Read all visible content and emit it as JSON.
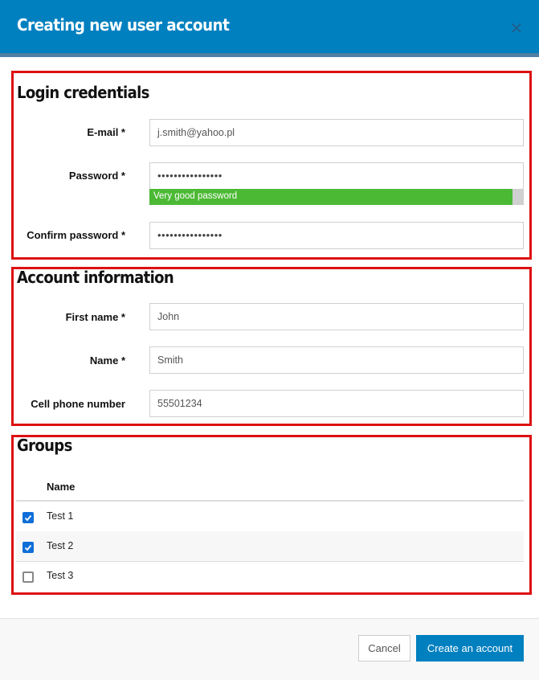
{
  "dialog": {
    "title": "Creating new user account",
    "close_icon": "close-x-icon",
    "colors": {
      "header": "#0180c0",
      "highlight_border": "#dd1111",
      "strength_good": "#4cb935",
      "primary_button": "#0180c0",
      "checkbox": "#0f6ed8"
    }
  },
  "login": {
    "title": "Login credentials",
    "email": {
      "label": "E-mail *",
      "value": "j.smith@yahoo.pl"
    },
    "password": {
      "label": "Password *",
      "value": "••••••••••••••••"
    },
    "strength": {
      "text": "Very good password",
      "fill_percent": 97
    },
    "confirm": {
      "label": "Confirm password *",
      "value": "••••••••••••••••"
    }
  },
  "account": {
    "title": "Account information",
    "first_name": {
      "label": "First name *",
      "value": "John"
    },
    "name": {
      "label": "Name *",
      "value": "Smith"
    },
    "phone": {
      "label": "Cell phone number",
      "value": "55501234"
    }
  },
  "groups": {
    "title": "Groups",
    "column_header": "Name",
    "rows": [
      {
        "name": "Test 1",
        "checked": true
      },
      {
        "name": "Test 2",
        "checked": true
      },
      {
        "name": "Test 3",
        "checked": false
      }
    ]
  },
  "footer": {
    "cancel_label": "Cancel",
    "create_label": "Create an account"
  }
}
